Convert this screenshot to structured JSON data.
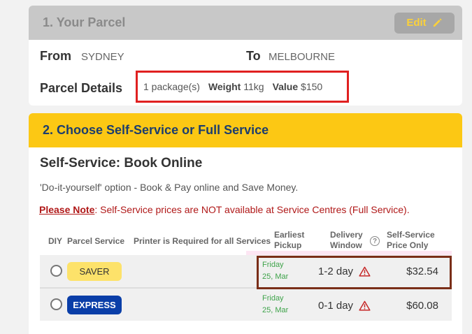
{
  "section1": {
    "title": "1. Your Parcel",
    "edit_label": "Edit",
    "from_label": "From",
    "from_value": "SYDNEY",
    "to_label": "To",
    "to_value": "MELBOURNE",
    "details_label": "Parcel Details",
    "packages": "1 package(s)",
    "weight_label": "Weight",
    "weight_value": "11kg",
    "value_label": "Value",
    "value_value": "$150"
  },
  "section2": {
    "title": "2. Choose Self-Service or Full Service",
    "subtitle": "Self-Service: Book Online",
    "description": "'Do-it-yourself' option - Book & Pay online and Save Money.",
    "note_link": "Please Note",
    "note_text": ": Self-Service prices are NOT available at Service Centres (Full Service)."
  },
  "table": {
    "headers": {
      "diy": "DIY",
      "parcel_service": "Parcel Service",
      "printer": "Printer is Required for all Services",
      "pickup_1": "Earliest",
      "pickup_2": "Pickup",
      "window_1": "Delivery",
      "window_2": "Window",
      "price_1": "Self-Service",
      "price_2": "Price Only"
    },
    "rows": [
      {
        "service": "SAVER",
        "pickup_day": "Friday",
        "pickup_date": "25, Mar",
        "window": "1-2 day",
        "price": "$32.54"
      },
      {
        "service": "EXPRESS",
        "pickup_day": "Friday",
        "pickup_date": "25, Mar",
        "window": "0-1 day",
        "price": "$60.08"
      }
    ]
  },
  "colors": {
    "header_yellow": "#fcc814",
    "header_grey": "#c8c8c8",
    "highlight_red": "#e02020",
    "express_blue": "#0a3ea8",
    "saver_yellow": "#fde26a",
    "note_red": "#b01818"
  },
  "icons": {
    "edit": "pencil-icon",
    "warning": "warning-triangle-icon",
    "help": "help-circle-icon"
  }
}
